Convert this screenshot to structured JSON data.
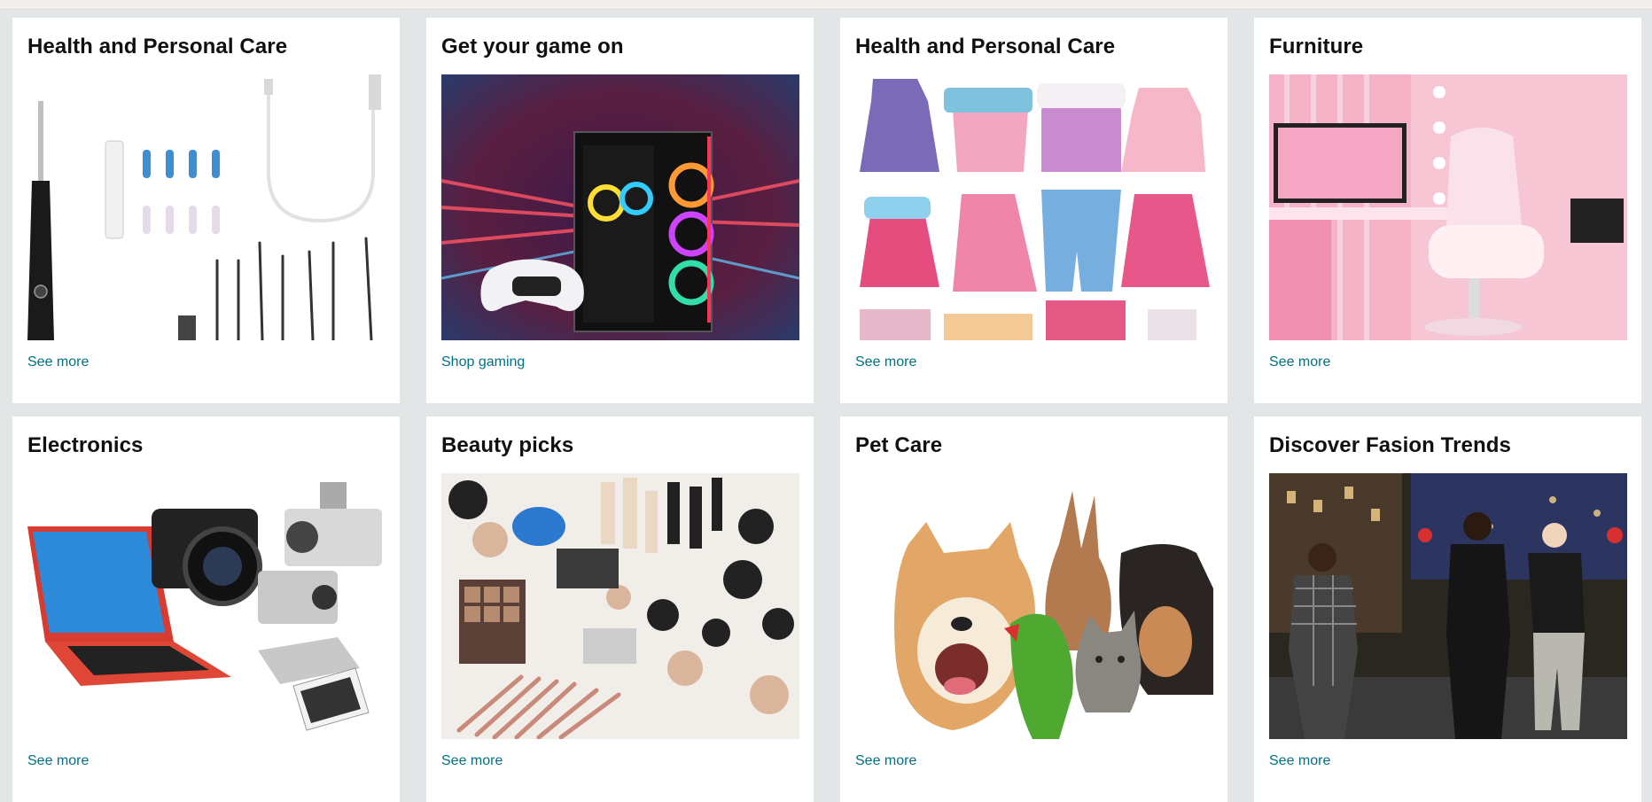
{
  "cards": [
    {
      "title": "Health and Personal Care",
      "link": "See more",
      "image": "ear-cleaning-camera-kit"
    },
    {
      "title": "Get your game on",
      "link": "Shop gaming",
      "image": "gaming-pc-with-controller"
    },
    {
      "title": "Health and Personal Care",
      "link": "See more",
      "image": "doll-dresses-collection"
    },
    {
      "title": "Furniture",
      "link": "See more",
      "image": "pink-gaming-room-chair"
    },
    {
      "title": "Electronics",
      "link": "See more",
      "image": "laptop-cameras-devices"
    },
    {
      "title": "Beauty picks",
      "link": "See more",
      "image": "makeup-products-flatlay"
    },
    {
      "title": "Pet Care",
      "link": "See more",
      "image": "dog-rabbit-parrot-cat"
    },
    {
      "title": "Discover Fasion Trends",
      "link": "See more",
      "image": "street-fashion-models"
    }
  ],
  "colors": {
    "background": "#e3e6e6",
    "card": "#ffffff",
    "title": "#0f1111",
    "link": "#007185"
  }
}
